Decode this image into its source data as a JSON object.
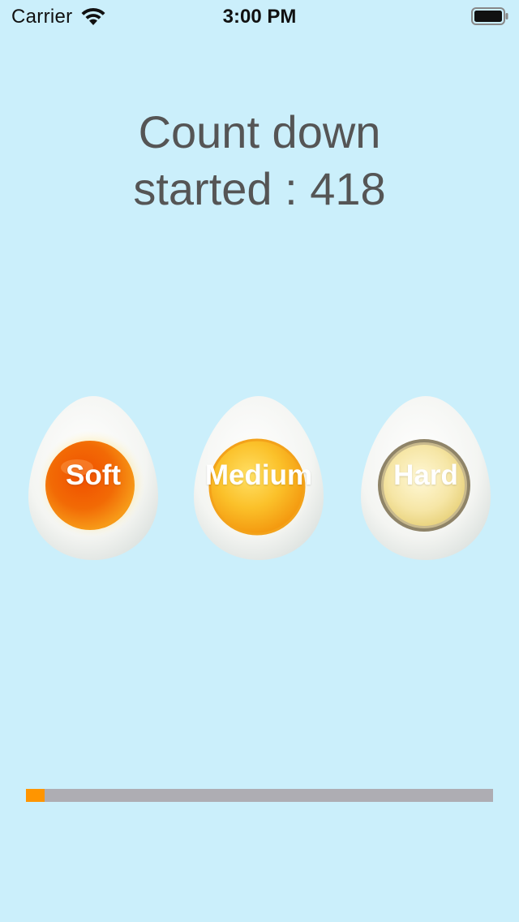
{
  "status_bar": {
    "carrier": "Carrier",
    "time": "3:00 PM",
    "wifi_icon": "wifi-icon",
    "battery_icon": "battery-full-icon"
  },
  "title": {
    "line1": "Count down",
    "line2": "started : 418"
  },
  "eggs": [
    {
      "label": "Soft",
      "yolk_color": "#F05A00"
    },
    {
      "label": "Medium",
      "yolk_color": "#FBBF1E"
    },
    {
      "label": "Hard",
      "yolk_color": "#F6E6A6"
    }
  ],
  "progress": {
    "value": 0.04,
    "fill_color": "#FF9500",
    "track_color": "#AEADB3"
  },
  "colors": {
    "background": "#CBEFFB",
    "title_text": "#555555"
  }
}
